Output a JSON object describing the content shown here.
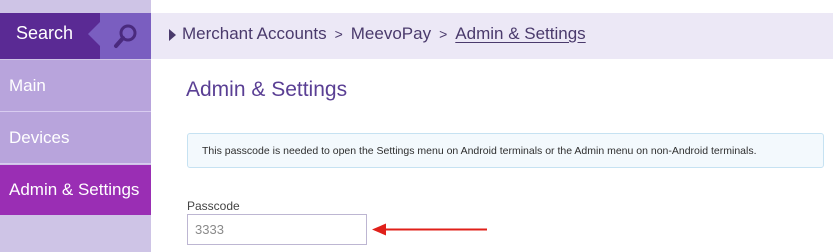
{
  "sidebar": {
    "search_label": "Search",
    "search_icon": "search-icon",
    "items": [
      {
        "label": "Main"
      },
      {
        "label": "Devices"
      },
      {
        "label": "Admin & Settings",
        "active": true
      }
    ]
  },
  "breadcrumb": {
    "items": [
      "Merchant Accounts",
      "MeevoPay",
      "Admin & Settings"
    ],
    "separator": ">"
  },
  "main": {
    "title": "Admin & Settings",
    "info_text": "This passcode is needed to open the Settings menu on Android terminals or the Admin menu on non-Android terminals.",
    "passcode_label": "Passcode",
    "passcode_value": "3333"
  },
  "colors": {
    "sidebar_bg": "#cec4e6",
    "search_bg": "#5a2a94",
    "active_item": "#9a2eb4",
    "accent_text": "#5a3f94",
    "annotation_arrow": "#e0201a"
  }
}
